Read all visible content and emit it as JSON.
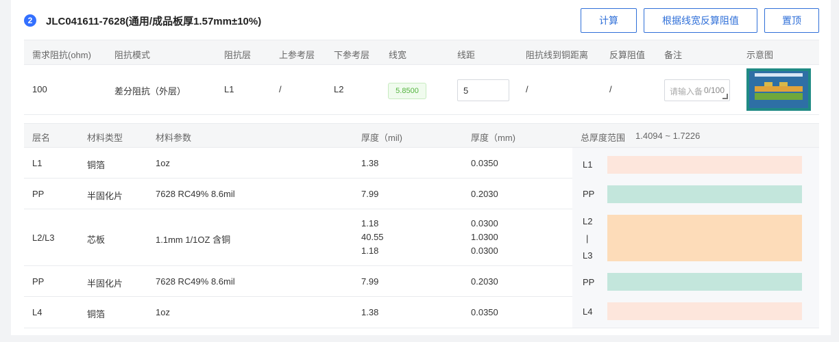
{
  "header": {
    "index": "2",
    "title": "JLC041611-7628(通用/成品板厚1.57mm±10%)",
    "buttons": {
      "calc": "计算",
      "reverse": "根据线宽反算阻值",
      "pin": "置顶"
    }
  },
  "impedance": {
    "columns": [
      "需求阻抗(ohm)",
      "阻抗模式",
      "阻抗层",
      "上参考层",
      "下参考层",
      "线宽",
      "线距",
      "阻抗线到铜距离",
      "反算阻值",
      "备注",
      "示意图"
    ],
    "row": {
      "impedance": "100",
      "mode": "差分阻抗（外层）",
      "layer": "L1",
      "upper_ref": "/",
      "lower_ref": "L2",
      "width": "5.8500",
      "spacing": "5",
      "copper_distance": "/",
      "reverse_value": "/",
      "remark_placeholder": "请输入备注",
      "remark_count": "0/100"
    }
  },
  "stackup": {
    "columns": [
      "层名",
      "材料类型",
      "材料参数",
      "厚度（mil)",
      "厚度（mm)"
    ],
    "total_label": "总厚度范围",
    "total_range": "1.4094 ~ 1.7226",
    "rows": [
      {
        "layer": "L1",
        "type": "铜箔",
        "param": "1oz",
        "mil": [
          "1.38"
        ],
        "mm": [
          "0.0350"
        ]
      },
      {
        "layer": "PP",
        "type": "半固化片",
        "param": "7628 RC49% 8.6mil",
        "mil": [
          "7.99"
        ],
        "mm": [
          "0.2030"
        ]
      },
      {
        "layer": "L2/L3",
        "type": "芯板",
        "param": "1.1mm 1/1OZ 含铜",
        "mil": [
          "1.18",
          "40.55",
          "1.18"
        ],
        "mm": [
          "0.0300",
          "1.0300",
          "0.0300"
        ]
      },
      {
        "layer": "PP",
        "type": "半固化片",
        "param": "7628 RC49% 8.6mil",
        "mil": [
          "7.99"
        ],
        "mm": [
          "0.2030"
        ]
      },
      {
        "layer": "L4",
        "type": "铜箔",
        "param": "1oz",
        "mil": [
          "1.38"
        ],
        "mm": [
          "0.0350"
        ]
      }
    ],
    "diagram": {
      "labels": {
        "l1": "L1",
        "pp1": "PP",
        "l2": "L2",
        "sep": "|",
        "l3": "L3",
        "pp2": "PP",
        "l4": "L4"
      }
    }
  },
  "colors": {
    "accent": "#2f6fd8",
    "copper": "#fde6dc",
    "prepreg": "#c3e6dc",
    "core": "#fddcb9",
    "width_pill_text": "#52b33d"
  }
}
